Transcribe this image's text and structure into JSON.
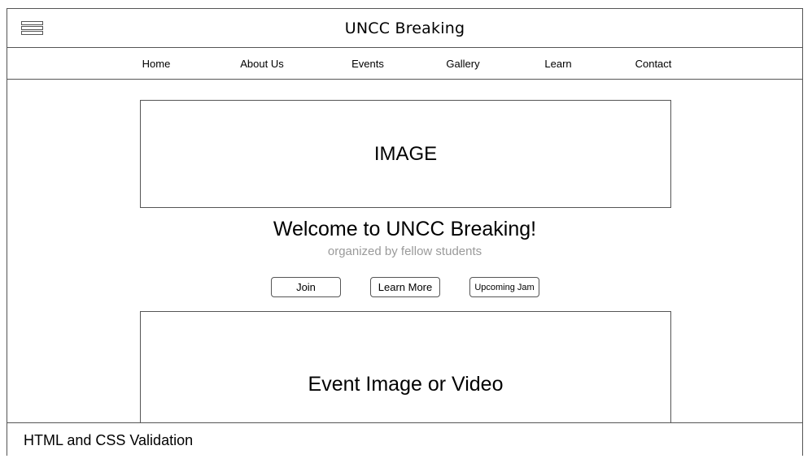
{
  "header": {
    "menu_icon": "hamburger-menu-icon",
    "title": "UNCC Breaking"
  },
  "nav": {
    "items": [
      {
        "label": "Home"
      },
      {
        "label": "About Us"
      },
      {
        "label": "Events"
      },
      {
        "label": "Gallery"
      },
      {
        "label": "Learn"
      },
      {
        "label": "Contact"
      }
    ]
  },
  "hero": {
    "image_label": "IMAGE",
    "welcome": "Welcome to UNCC Breaking!",
    "subtitle": "organized by fellow students"
  },
  "buttons": {
    "join": "Join",
    "learn_more": "Learn More",
    "upcoming_jam": "Upcoming Jam"
  },
  "event": {
    "media_label": "Event Image or Video"
  },
  "footer": {
    "text": "HTML and CSS Validation"
  },
  "colors": {
    "border": "#555555",
    "subtitle": "#9a9a9a",
    "background": "#ffffff"
  }
}
